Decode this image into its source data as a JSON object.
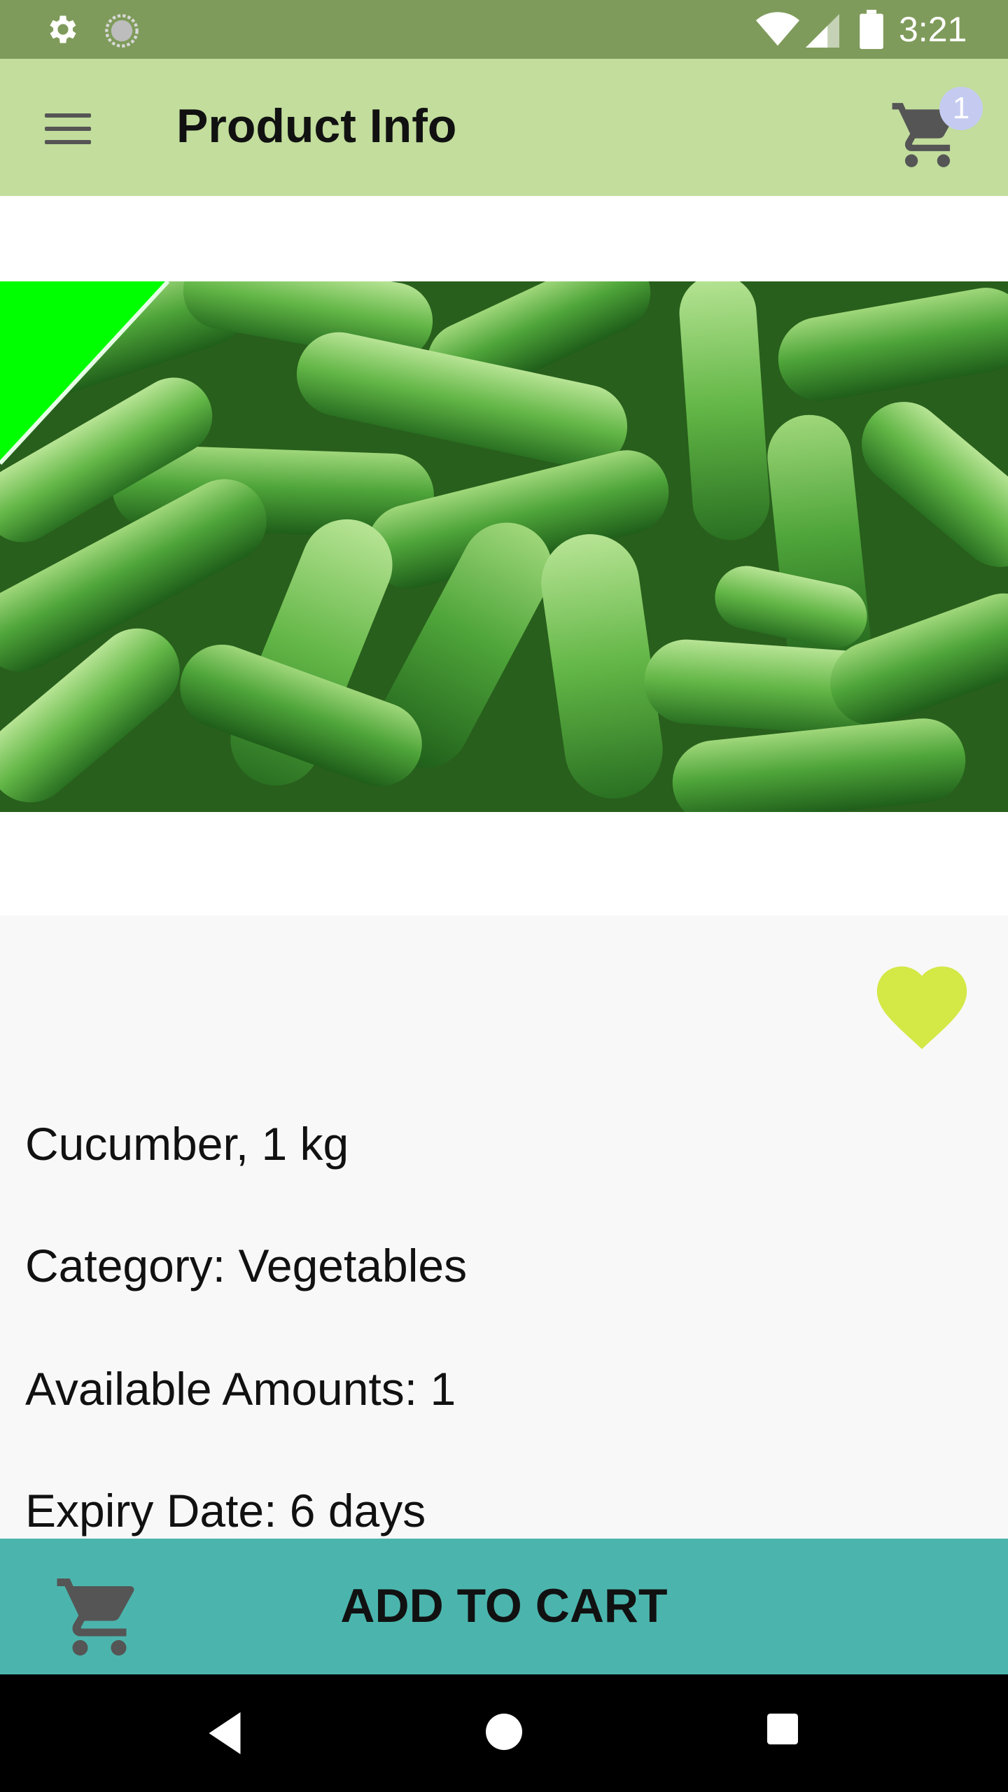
{
  "status_bar": {
    "time": "3:21",
    "icons": [
      "gear-icon",
      "loading-icon",
      "wifi-icon",
      "signal-icon",
      "battery-icon"
    ]
  },
  "app_bar": {
    "title": "Product Info",
    "cart_count": "1",
    "icons": [
      "menu-icon",
      "cart-icon"
    ],
    "color": "#c2dd9c"
  },
  "product": {
    "image": "cucumbers-photo",
    "corner_ribbon_color": "#00ff00",
    "name": "Cucumber, 1 kg",
    "category": "Category: Vegetables",
    "available": "Available Amounts: 1",
    "expiry": "Expiry Date: 6 days",
    "favorite_icon": "heart-icon",
    "favorite_color": "#d4e846"
  },
  "actions": {
    "add_to_cart_label": "ADD TO CART",
    "button_color": "#4bb5ad"
  },
  "nav_bar": {
    "icons": [
      "back-icon",
      "home-icon",
      "recents-icon"
    ]
  }
}
